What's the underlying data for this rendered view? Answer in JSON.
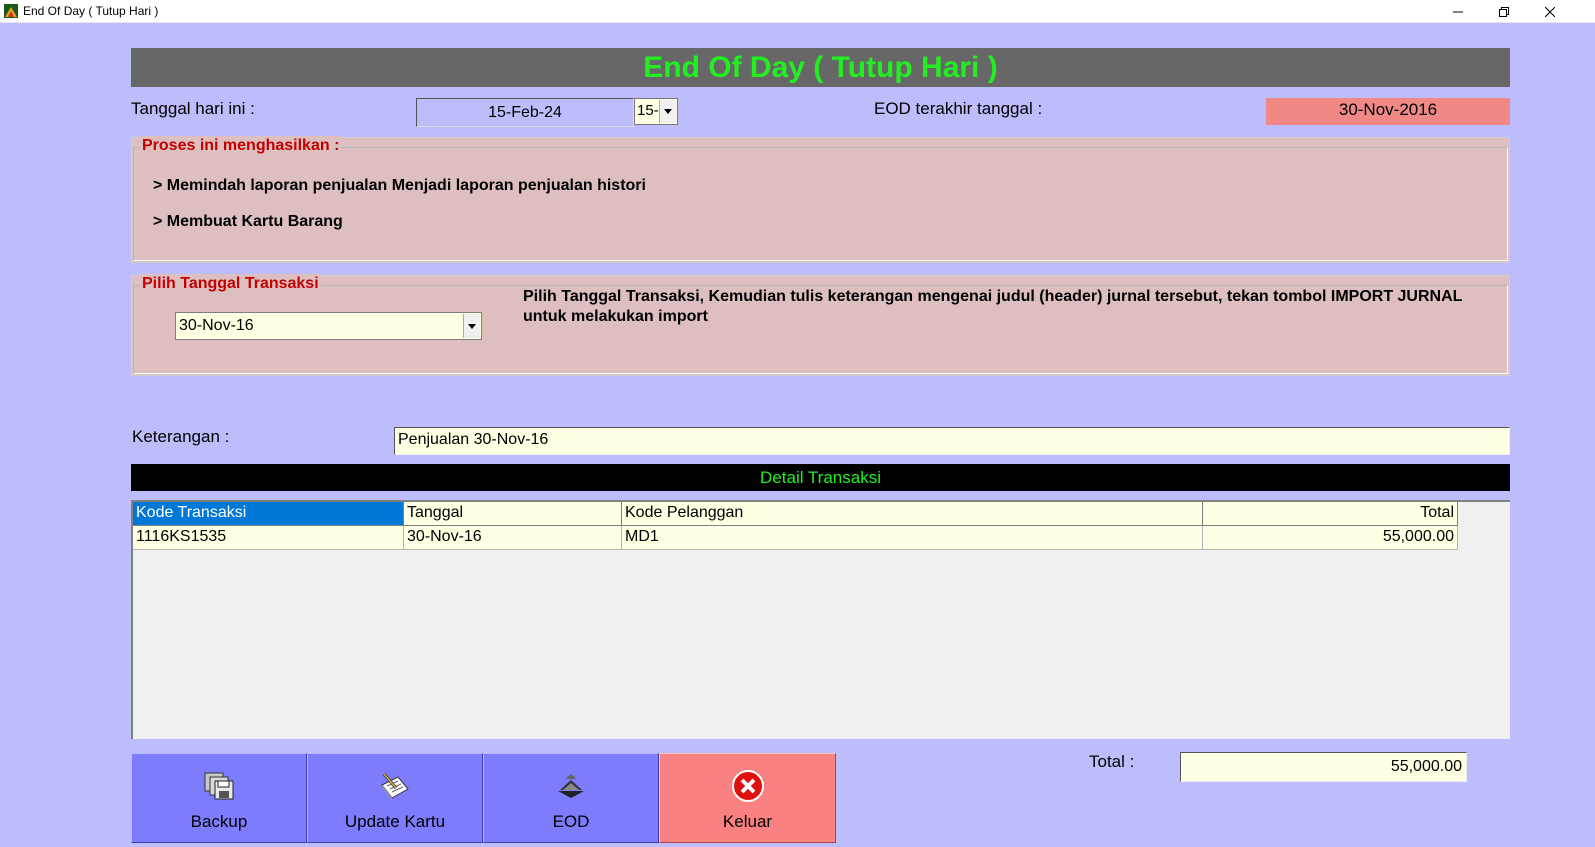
{
  "window": {
    "title": "End Of Day ( Tutup Hari )",
    "controls": [
      "minimize",
      "restore",
      "close"
    ]
  },
  "header": {
    "title": "End Of Day ( Tutup Hari )"
  },
  "today": {
    "label": "Tanggal hari ini :",
    "value": "15-Feb-24",
    "picker_value": "15-"
  },
  "last_eod": {
    "label": "EOD terakhir tanggal :",
    "value": "30-Nov-2016"
  },
  "process_group": {
    "legend": "Proses ini menghasilkan :",
    "lines": [
      "> Memindah laporan penjualan Menjadi laporan penjualan histori",
      "> Membuat Kartu Barang"
    ]
  },
  "date_select_group": {
    "legend": "Pilih Tanggal Transaksi",
    "selected": "30-Nov-16",
    "help_text": "Pilih Tanggal Transaksi, Kemudian tulis keterangan mengenai judul (header) jurnal tersebut, tekan tombol IMPORT JURNAL untuk melakukan import"
  },
  "keterangan": {
    "label": "Keterangan :",
    "value": "Penjualan 30-Nov-16"
  },
  "detail": {
    "title": "Detail Transaksi",
    "columns": [
      "Kode Transaksi",
      "Tanggal",
      "Kode Pelanggan",
      "Total"
    ],
    "rows": [
      [
        "1116KS1535",
        "30-Nov-16",
        "MD1",
        "55,000.00"
      ]
    ]
  },
  "buttons": {
    "backup": "Backup",
    "update_kartu": "Update Kartu",
    "eod": "EOD",
    "keluar": "Keluar"
  },
  "total": {
    "label": "Total :",
    "value": "55,000.00"
  },
  "colors": {
    "background": "#bdbdfb",
    "header_bar": "#676767",
    "header_text": "#22ee22",
    "group_bg": "#debfc0",
    "legend_text": "#c40000",
    "field_bg": "#ffffe3",
    "last_eod_bg": "#f08886",
    "button_blue": "#7c7cfc",
    "button_red": "#f98181",
    "selection": "#0078d7"
  }
}
